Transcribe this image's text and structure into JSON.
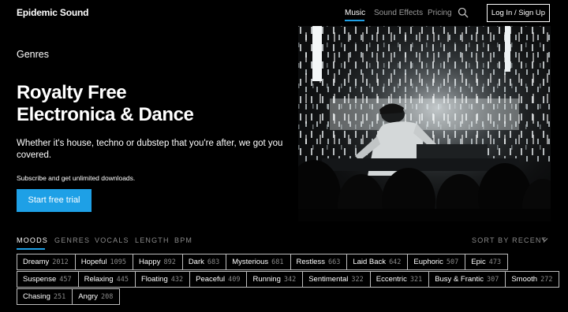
{
  "header": {
    "logo": "Epidemic Sound",
    "nav": [
      "Music",
      "Sound Effects",
      "Pricing"
    ],
    "login": "Log In / Sign Up"
  },
  "hero": {
    "kicker": "Genres",
    "title_line1": "Royalty Free",
    "title_line2": "Electronica & Dance",
    "description": "Whether it's house, techno or dubstep that you're after, we got you covered.",
    "note": "Subscribe and get unlimited downloads.",
    "cta": "Start free trial"
  },
  "filters": {
    "tabs": [
      "MOODS",
      "GENRES",
      "VOCALS",
      "LENGTH",
      "BPM"
    ],
    "active_tab": "MOODS",
    "sort": "SORT BY RECENT"
  },
  "moods": [
    [
      {
        "name": "Dreamy",
        "count": "2012"
      },
      {
        "name": "Hopeful",
        "count": "1095"
      },
      {
        "name": "Happy",
        "count": "892"
      },
      {
        "name": "Dark",
        "count": "683"
      },
      {
        "name": "Mysterious",
        "count": "681"
      },
      {
        "name": "Restless",
        "count": "663"
      },
      {
        "name": "Laid Back",
        "count": "642"
      },
      {
        "name": "Euphoric",
        "count": "507"
      },
      {
        "name": "Epic",
        "count": "473"
      }
    ],
    [
      {
        "name": "Suspense",
        "count": "457"
      },
      {
        "name": "Relaxing",
        "count": "445"
      },
      {
        "name": "Floating",
        "count": "432"
      },
      {
        "name": "Peaceful",
        "count": "409"
      },
      {
        "name": "Running",
        "count": "342"
      },
      {
        "name": "Sentimental",
        "count": "322"
      },
      {
        "name": "Eccentric",
        "count": "321"
      },
      {
        "name": "Busy & Frantic",
        "count": "307"
      },
      {
        "name": "Smooth",
        "count": "272"
      }
    ],
    [
      {
        "name": "Chasing",
        "count": "251"
      },
      {
        "name": "Angry",
        "count": "208"
      }
    ]
  ],
  "colors": {
    "accent": "#1ea0e6",
    "background": "#000000"
  }
}
